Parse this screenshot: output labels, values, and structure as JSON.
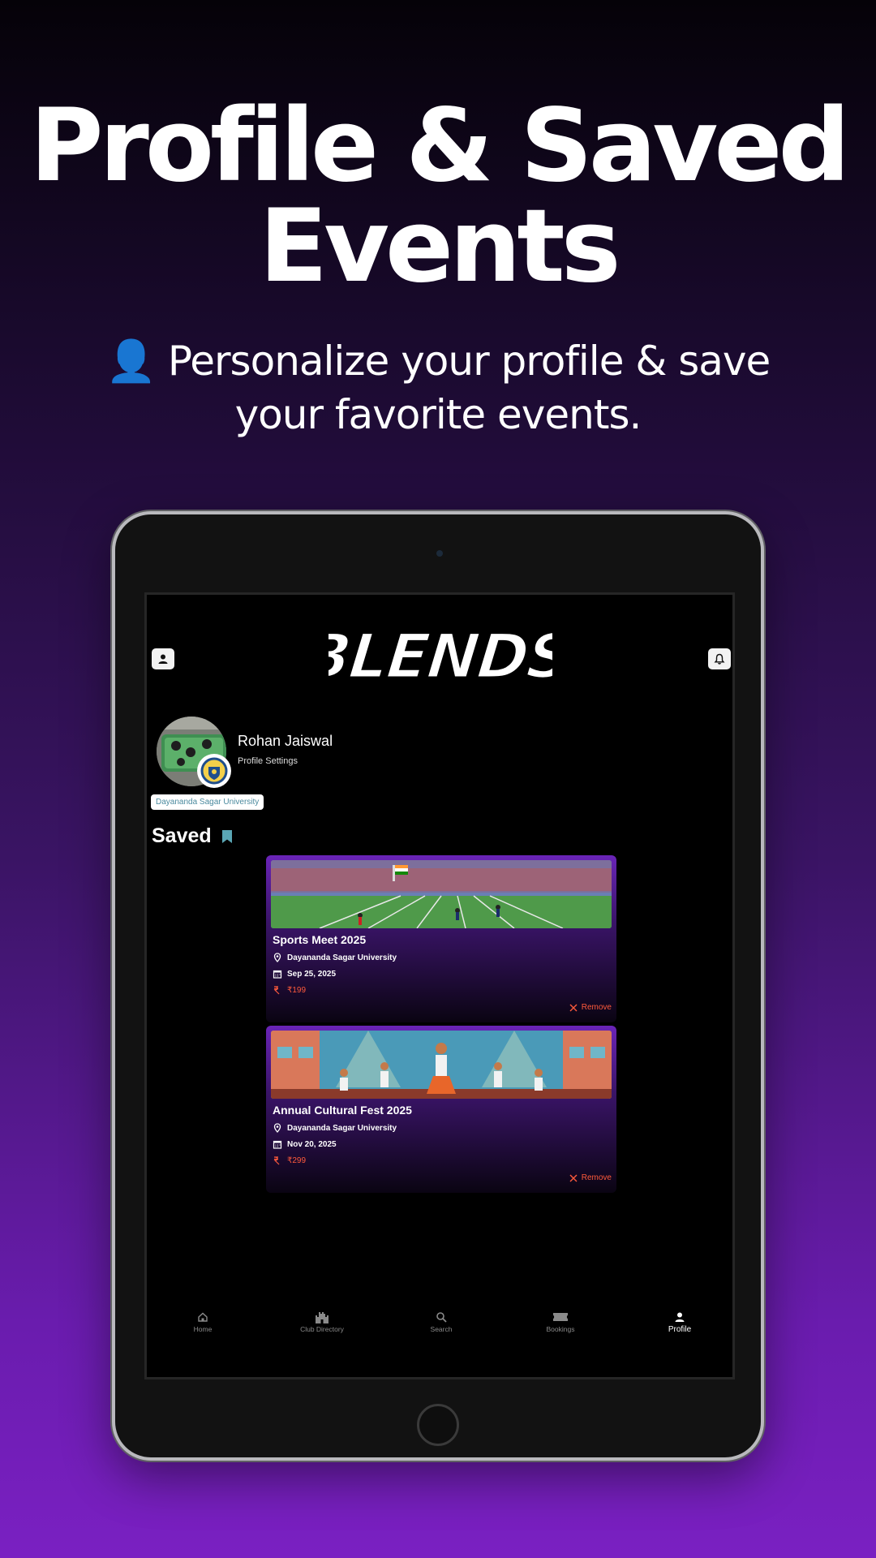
{
  "hero": {
    "title_line1": "Profile & Saved",
    "title_line2": "Events",
    "subtitle_line1": "👤 Personalize your profile & save",
    "subtitle_line2": "your favorite events."
  },
  "app": {
    "logo_text": "BLENDS",
    "profile": {
      "name": "Rohan Jaiswal",
      "settings_label": "Profile Settings",
      "university": "Dayananda Sagar University"
    },
    "saved_heading": "Saved",
    "saved_events": [
      {
        "title": "Sports Meet 2025",
        "location": "Dayananda Sagar University",
        "date": "Sep 25, 2025",
        "price": "₹199",
        "remove_label": "Remove"
      },
      {
        "title": "Annual Cultural Fest 2025",
        "location": "Dayananda Sagar University",
        "date": "Nov 20, 2025",
        "price": "₹299",
        "remove_label": "Remove"
      }
    ],
    "nav": [
      {
        "label": "Home",
        "icon": "home-icon"
      },
      {
        "label": "Club Directory",
        "icon": "castle-icon"
      },
      {
        "label": "Search",
        "icon": "search-icon"
      },
      {
        "label": "Bookings",
        "icon": "ticket-icon"
      },
      {
        "label": "Profile",
        "icon": "person-icon",
        "active": true
      }
    ]
  },
  "colors": {
    "accent_purple": "#6a24b8",
    "price_red": "#ff5a3c",
    "bookmark_teal": "#5aa6b4"
  }
}
